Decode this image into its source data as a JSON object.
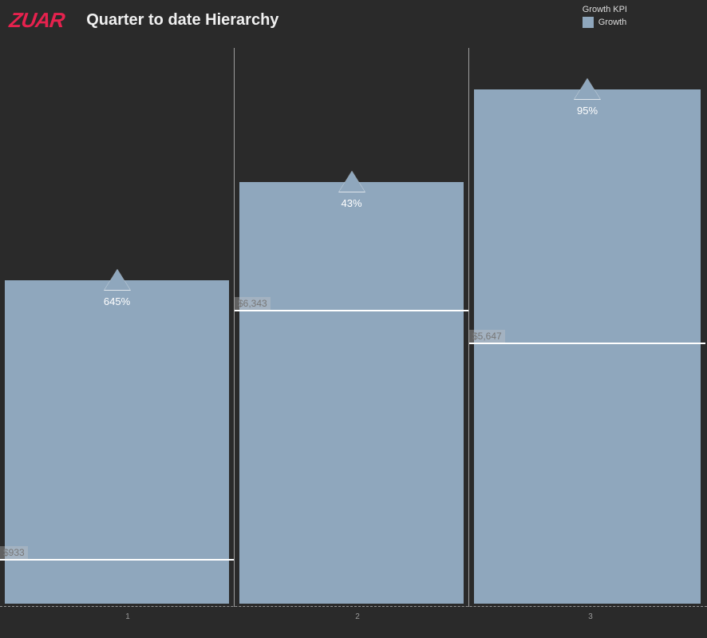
{
  "header": {
    "logo": "ZUAR",
    "title": "Quarter to date Hierarchy"
  },
  "legend": {
    "title": "Growth KPI",
    "item_label": "Growth",
    "swatch_color": "#8fa7bd"
  },
  "chart_data": {
    "type": "bar",
    "categories": [
      "1",
      "2",
      "3"
    ],
    "series": [
      {
        "name": "Growth",
        "values": [
          6950,
          9060,
          11040
        ],
        "growth_pct": [
          "645%",
          "43%",
          "95%"
        ],
        "reference_values": [
          933,
          6343,
          5647
        ],
        "reference_labels": [
          "$933",
          "$6,343",
          "$5,647"
        ]
      }
    ],
    "ylim": [
      0,
      12000
    ],
    "title": "Quarter to date Hierarchy",
    "xlabel": "",
    "ylabel": ""
  }
}
